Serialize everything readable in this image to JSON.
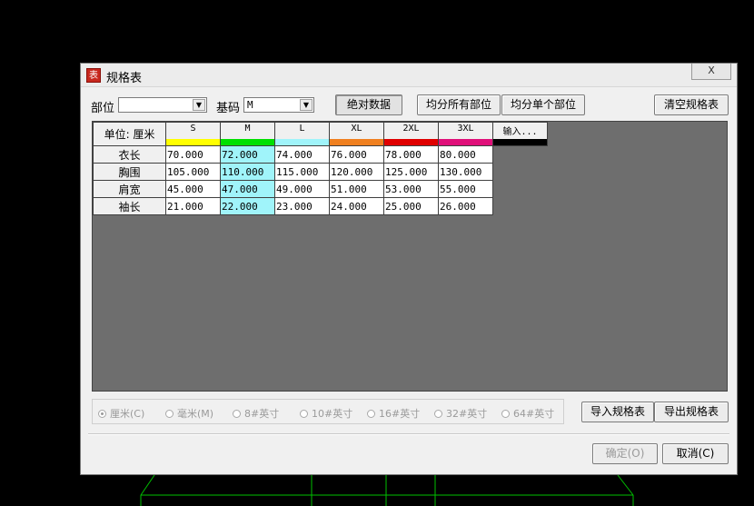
{
  "window": {
    "title": "规格表",
    "icon": "app-seal-icon",
    "close_label": "X"
  },
  "toolbar": {
    "part_label": "部位",
    "part_value": "",
    "base_label": "基码",
    "base_value": "M",
    "abs_data_label": "绝对数据",
    "avg_all_label": "均分所有部位",
    "avg_single_label": "均分单个部位",
    "clear_label": "清空规格表"
  },
  "table": {
    "unit_header": "单位: 厘米",
    "sizes": [
      {
        "name": "S",
        "color": "#ffff00"
      },
      {
        "name": "M",
        "color": "#00e000"
      },
      {
        "name": "L",
        "color": "#a0f4fa"
      },
      {
        "name": "XL",
        "color": "#f08020"
      },
      {
        "name": "2XL",
        "color": "#e00000"
      },
      {
        "name": "3XL",
        "color": "#e0107a"
      },
      {
        "name": "输入...",
        "color": "#000000"
      }
    ],
    "rows": [
      {
        "part": "衣长",
        "values": [
          "70.000",
          "72.000",
          "74.000",
          "76.000",
          "78.000",
          "80.000"
        ]
      },
      {
        "part": "胸围",
        "values": [
          "105.000",
          "110.000",
          "115.000",
          "120.000",
          "125.000",
          "130.000"
        ]
      },
      {
        "part": "肩宽",
        "values": [
          "45.000",
          "47.000",
          "49.000",
          "51.000",
          "53.000",
          "55.000"
        ]
      },
      {
        "part": "袖长",
        "values": [
          "21.000",
          "22.000",
          "23.000",
          "24.000",
          "25.000",
          "26.000"
        ]
      }
    ],
    "highlight_color": "#a0f4fa"
  },
  "units": {
    "options": [
      "厘米(C)",
      "毫米(M)",
      "8#英寸",
      "10#英寸",
      "16#英寸",
      "32#英寸",
      "64#英寸"
    ],
    "selected": "厘米(C)"
  },
  "buttons": {
    "import_label": "导入规格表",
    "export_label": "导出规格表",
    "ok_label": "确定(O)",
    "cancel_label": "取消(C)"
  }
}
